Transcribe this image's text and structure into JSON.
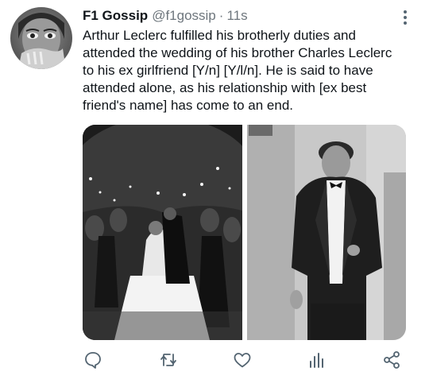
{
  "tweet": {
    "display_name": "F1 Gossip",
    "handle": "@f1gossip",
    "separator": "·",
    "timestamp": "11s",
    "text_lines": [
      "Arthur Leclerc fulfilled his brotherly duties and",
      "attended the wedding of his brother Charles Leclerc",
      "to his ex girlfriend [Y/n] [Y/l/n]. He is said to have",
      "attended alone, as his relationship with [ex best",
      "friend's name] has come to an end."
    ]
  },
  "icons": {
    "more": "more-vertical-icon",
    "reply": "reply-icon",
    "retweet": "retweet-icon",
    "like": "heart-icon",
    "analytics": "analytics-icon",
    "share": "share-icon"
  },
  "colors": {
    "text": "#0f1419",
    "secondary_text": "#6e767d",
    "icon": "#536471",
    "background": "#ffffff"
  }
}
